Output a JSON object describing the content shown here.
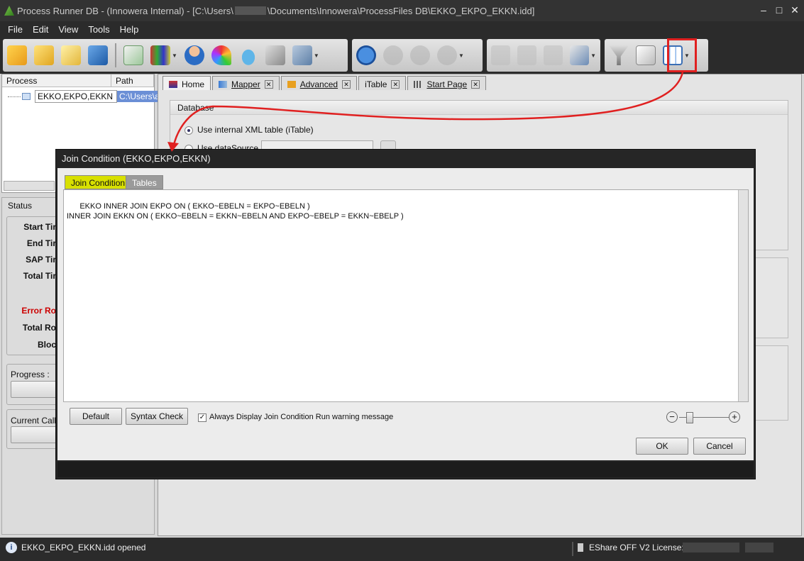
{
  "window": {
    "title_prefix": "Process Runner DB - (Innowera Internal) - [C:\\Users\\",
    "title_suffix": "\\Documents\\Innowera\\ProcessFiles DB\\EKKO_EKPO_EKKN.idd]",
    "minimize": "–",
    "maximize": "□",
    "close": "✕"
  },
  "menu": [
    "File",
    "Edit",
    "View",
    "Tools",
    "Help"
  ],
  "process_panel": {
    "col_process": "Process",
    "col_path": "Path",
    "row_process": "EKKO,EKPO,EKKN",
    "row_path": "C:\\Users\\an"
  },
  "status_panel": {
    "header": "Status",
    "labels": [
      "Start Tir",
      "End Tir",
      "SAP Tir",
      "Total Tir"
    ],
    "error_rows": "Error Ro",
    "total_rows": "Total Ro",
    "block": "Bloc",
    "progress": "Progress :",
    "current_call": "Current Call D"
  },
  "tabs": [
    {
      "label": "Home",
      "closable": false
    },
    {
      "label": "Mapper",
      "closable": true
    },
    {
      "label": "Advanced",
      "closable": true
    },
    {
      "label": "iTable",
      "closable": true
    },
    {
      "label": "Start Page",
      "closable": true
    }
  ],
  "database_group": {
    "title": "Database",
    "option_internal": "Use internal XML table (iTable)",
    "option_datasource": "Use dataSource"
  },
  "dialog": {
    "title": "Join Condition (EKKO,EKPO,EKKN)",
    "tab_join": "Join Condition",
    "tab_tables": "Tables",
    "join_text": "EKKO INNER JOIN EKPO ON ( EKKO~EBELN = EKPO~EBELN )\nINNER JOIN EKKN ON ( EKKO~EBELN = EKKN~EBELN AND EKPO~EBELP = EKKN~EBELP )",
    "default_button": "Default",
    "syntax_button": "Syntax Check",
    "warning_checkbox": "Always Display Join Condition Run warning message",
    "warning_checked": true,
    "ok_button": "OK",
    "cancel_button": "Cancel",
    "zoom_minus": "−",
    "zoom_plus": "+"
  },
  "statusbar": {
    "message": "EKKO_EKPO_EKKN.idd opened",
    "eshare": "EShare OFF",
    "license": "V2 License:"
  },
  "colors": {
    "highlight": "#e02020",
    "error_text": "#cc0000",
    "active_tab": "#d8e000",
    "chrome": "#2b2b2b"
  }
}
